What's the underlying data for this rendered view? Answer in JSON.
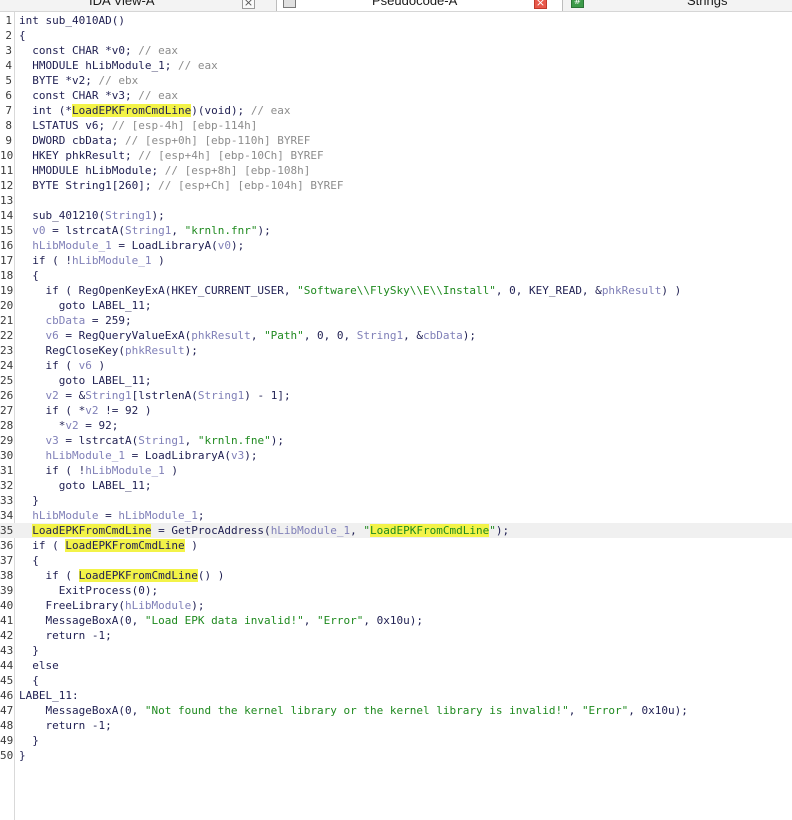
{
  "tabs": [
    {
      "title": "IDA View-A",
      "close": "×",
      "active": false
    },
    {
      "title": "Pseudocode-A",
      "close": "×",
      "active": true
    },
    {
      "title": "Strings",
      "icon": "#",
      "active": false
    }
  ],
  "highlight_word": "LoadEPKFromCmdLine",
  "code_lines": [
    {
      "n": "1",
      "parts": [
        {
          "t": "int sub_4010AD()",
          "k": "p"
        }
      ]
    },
    {
      "n": "2",
      "parts": [
        {
          "t": "{",
          "k": "p"
        }
      ]
    },
    {
      "n": "3",
      "parts": [
        {
          "t": "  const CHAR *v0; ",
          "k": "p"
        },
        {
          "t": "// eax",
          "k": "c"
        }
      ]
    },
    {
      "n": "4",
      "parts": [
        {
          "t": "  HMODULE hLibModule_1; ",
          "k": "p"
        },
        {
          "t": "// eax",
          "k": "c"
        }
      ]
    },
    {
      "n": "5",
      "parts": [
        {
          "t": "  BYTE *v2; ",
          "k": "p"
        },
        {
          "t": "// ebx",
          "k": "c"
        }
      ]
    },
    {
      "n": "6",
      "parts": [
        {
          "t": "  const CHAR *v3; ",
          "k": "p"
        },
        {
          "t": "// eax",
          "k": "c"
        }
      ]
    },
    {
      "n": "7",
      "parts": [
        {
          "t": "  int (*",
          "k": "p"
        },
        {
          "t": "LoadEPKFromCmdLine",
          "k": "h"
        },
        {
          "t": ")(void); ",
          "k": "p"
        },
        {
          "t": "// eax",
          "k": "c"
        }
      ]
    },
    {
      "n": "8",
      "parts": [
        {
          "t": "  LSTATUS v6; ",
          "k": "p"
        },
        {
          "t": "// [esp-4h] [ebp-114h]",
          "k": "c"
        }
      ]
    },
    {
      "n": "9",
      "parts": [
        {
          "t": "  DWORD cbData; ",
          "k": "p"
        },
        {
          "t": "// [esp+0h] [ebp-110h] BYREF",
          "k": "c"
        }
      ]
    },
    {
      "n": "10",
      "parts": [
        {
          "t": "  HKEY phkResult; ",
          "k": "p"
        },
        {
          "t": "// [esp+4h] [ebp-10Ch] BYREF",
          "k": "c"
        }
      ]
    },
    {
      "n": "11",
      "parts": [
        {
          "t": "  HMODULE hLibModule; ",
          "k": "p"
        },
        {
          "t": "// [esp+8h] [ebp-108h]",
          "k": "c"
        }
      ]
    },
    {
      "n": "12",
      "parts": [
        {
          "t": "  BYTE String1[260]; ",
          "k": "p"
        },
        {
          "t": "// [esp+Ch] [ebp-104h] BYREF",
          "k": "c"
        }
      ]
    },
    {
      "n": "13",
      "parts": []
    },
    {
      "n": "14",
      "parts": [
        {
          "t": "  sub_401210(",
          "k": "p"
        },
        {
          "t": "String1",
          "k": "v"
        },
        {
          "t": ");",
          "k": "p"
        }
      ]
    },
    {
      "n": "15",
      "parts": [
        {
          "t": "  ",
          "k": "p"
        },
        {
          "t": "v0",
          "k": "v"
        },
        {
          "t": " = lstrcatA(",
          "k": "p"
        },
        {
          "t": "String1",
          "k": "v"
        },
        {
          "t": ", ",
          "k": "p"
        },
        {
          "t": "\"krnln.fnr\"",
          "k": "s"
        },
        {
          "t": ");",
          "k": "p"
        }
      ]
    },
    {
      "n": "16",
      "parts": [
        {
          "t": "  ",
          "k": "p"
        },
        {
          "t": "hLibModule_1",
          "k": "v"
        },
        {
          "t": " = LoadLibraryA(",
          "k": "p"
        },
        {
          "t": "v0",
          "k": "v"
        },
        {
          "t": ");",
          "k": "p"
        }
      ]
    },
    {
      "n": "17",
      "parts": [
        {
          "t": "  if ( !",
          "k": "p"
        },
        {
          "t": "hLibModule_1",
          "k": "v"
        },
        {
          "t": " )",
          "k": "p"
        }
      ]
    },
    {
      "n": "18",
      "parts": [
        {
          "t": "  {",
          "k": "p"
        }
      ]
    },
    {
      "n": "19",
      "parts": [
        {
          "t": "    if ( RegOpenKeyExA(HKEY_CURRENT_USER, ",
          "k": "p"
        },
        {
          "t": "\"Software\\\\FlySky\\\\E\\\\Install\"",
          "k": "s"
        },
        {
          "t": ", 0, KEY_READ, &",
          "k": "p"
        },
        {
          "t": "phkResult",
          "k": "v"
        },
        {
          "t": ") )",
          "k": "p"
        }
      ]
    },
    {
      "n": "20",
      "parts": [
        {
          "t": "      goto LABEL_11;",
          "k": "p"
        }
      ]
    },
    {
      "n": "21",
      "parts": [
        {
          "t": "    ",
          "k": "p"
        },
        {
          "t": "cbData",
          "k": "v"
        },
        {
          "t": " = 259;",
          "k": "p"
        }
      ]
    },
    {
      "n": "22",
      "parts": [
        {
          "t": "    ",
          "k": "p"
        },
        {
          "t": "v6",
          "k": "v"
        },
        {
          "t": " = RegQueryValueExA(",
          "k": "p"
        },
        {
          "t": "phkResult",
          "k": "v"
        },
        {
          "t": ", ",
          "k": "p"
        },
        {
          "t": "\"Path\"",
          "k": "s"
        },
        {
          "t": ", 0, 0, ",
          "k": "p"
        },
        {
          "t": "String1",
          "k": "v"
        },
        {
          "t": ", &",
          "k": "p"
        },
        {
          "t": "cbData",
          "k": "v"
        },
        {
          "t": ");",
          "k": "p"
        }
      ]
    },
    {
      "n": "23",
      "parts": [
        {
          "t": "    RegCloseKey(",
          "k": "p"
        },
        {
          "t": "phkResult",
          "k": "v"
        },
        {
          "t": ");",
          "k": "p"
        }
      ]
    },
    {
      "n": "24",
      "parts": [
        {
          "t": "    if ( ",
          "k": "p"
        },
        {
          "t": "v6",
          "k": "v"
        },
        {
          "t": " )",
          "k": "p"
        }
      ]
    },
    {
      "n": "25",
      "parts": [
        {
          "t": "      goto LABEL_11;",
          "k": "p"
        }
      ]
    },
    {
      "n": "26",
      "parts": [
        {
          "t": "    ",
          "k": "p"
        },
        {
          "t": "v2",
          "k": "v"
        },
        {
          "t": " = &",
          "k": "p"
        },
        {
          "t": "String1",
          "k": "v"
        },
        {
          "t": "[lstrlenA(",
          "k": "p"
        },
        {
          "t": "String1",
          "k": "v"
        },
        {
          "t": ") - 1];",
          "k": "p"
        }
      ]
    },
    {
      "n": "27",
      "parts": [
        {
          "t": "    if ( *",
          "k": "p"
        },
        {
          "t": "v2",
          "k": "v"
        },
        {
          "t": " != 92 )",
          "k": "p"
        }
      ]
    },
    {
      "n": "28",
      "parts": [
        {
          "t": "      *",
          "k": "p"
        },
        {
          "t": "v2",
          "k": "v"
        },
        {
          "t": " = 92;",
          "k": "p"
        }
      ]
    },
    {
      "n": "29",
      "parts": [
        {
          "t": "    ",
          "k": "p"
        },
        {
          "t": "v3",
          "k": "v"
        },
        {
          "t": " = lstrcatA(",
          "k": "p"
        },
        {
          "t": "String1",
          "k": "v"
        },
        {
          "t": ", ",
          "k": "p"
        },
        {
          "t": "\"krnln.fne\"",
          "k": "s"
        },
        {
          "t": ");",
          "k": "p"
        }
      ]
    },
    {
      "n": "30",
      "parts": [
        {
          "t": "    ",
          "k": "p"
        },
        {
          "t": "hLibModule_1",
          "k": "v"
        },
        {
          "t": " = LoadLibraryA(",
          "k": "p"
        },
        {
          "t": "v3",
          "k": "v"
        },
        {
          "t": ");",
          "k": "p"
        }
      ]
    },
    {
      "n": "31",
      "parts": [
        {
          "t": "    if ( !",
          "k": "p"
        },
        {
          "t": "hLibModule_1",
          "k": "v"
        },
        {
          "t": " )",
          "k": "p"
        }
      ]
    },
    {
      "n": "32",
      "parts": [
        {
          "t": "      goto LABEL_11;",
          "k": "p"
        }
      ]
    },
    {
      "n": "33",
      "parts": [
        {
          "t": "  }",
          "k": "p"
        }
      ]
    },
    {
      "n": "34",
      "parts": [
        {
          "t": "  ",
          "k": "p"
        },
        {
          "t": "hLibModule",
          "k": "v"
        },
        {
          "t": " = ",
          "k": "p"
        },
        {
          "t": "hLibModule_1",
          "k": "v"
        },
        {
          "t": ";",
          "k": "p"
        }
      ]
    },
    {
      "n": "35",
      "cur": true,
      "parts": [
        {
          "t": "  ",
          "k": "p"
        },
        {
          "t": "LoadEPKFromCmdLine",
          "k": "h"
        },
        {
          "t": " = GetProcAddress(",
          "k": "p"
        },
        {
          "t": "hLibModule_1",
          "k": "v"
        },
        {
          "t": ", ",
          "k": "p"
        },
        {
          "t": "\"",
          "k": "s"
        },
        {
          "t": "LoadEPKFromCmdLine",
          "k": "hs"
        },
        {
          "t": "\"",
          "k": "s"
        },
        {
          "t": ");",
          "k": "p"
        }
      ]
    },
    {
      "n": "36",
      "parts": [
        {
          "t": "  if ( ",
          "k": "p"
        },
        {
          "t": "LoadEPKFromCmdLine",
          "k": "h"
        },
        {
          "t": " )",
          "k": "p"
        }
      ]
    },
    {
      "n": "37",
      "parts": [
        {
          "t": "  {",
          "k": "p"
        }
      ]
    },
    {
      "n": "38",
      "parts": [
        {
          "t": "    if ( ",
          "k": "p"
        },
        {
          "t": "LoadEPKFromCmdLine",
          "k": "h"
        },
        {
          "t": "() )",
          "k": "p"
        }
      ]
    },
    {
      "n": "39",
      "parts": [
        {
          "t": "      ExitProcess(0);",
          "k": "p"
        }
      ]
    },
    {
      "n": "40",
      "parts": [
        {
          "t": "    FreeLibrary(",
          "k": "p"
        },
        {
          "t": "hLibModule",
          "k": "v"
        },
        {
          "t": ");",
          "k": "p"
        }
      ]
    },
    {
      "n": "41",
      "parts": [
        {
          "t": "    MessageBoxA(0, ",
          "k": "p"
        },
        {
          "t": "\"Load EPK data invalid!\"",
          "k": "s"
        },
        {
          "t": ", ",
          "k": "p"
        },
        {
          "t": "\"Error\"",
          "k": "s"
        },
        {
          "t": ", 0x10u);",
          "k": "p"
        }
      ]
    },
    {
      "n": "42",
      "parts": [
        {
          "t": "    return -1;",
          "k": "p"
        }
      ]
    },
    {
      "n": "43",
      "parts": [
        {
          "t": "  }",
          "k": "p"
        }
      ]
    },
    {
      "n": "44",
      "parts": [
        {
          "t": "  else",
          "k": "p"
        }
      ]
    },
    {
      "n": "45",
      "parts": [
        {
          "t": "  {",
          "k": "p"
        }
      ]
    },
    {
      "n": "46",
      "parts": [
        {
          "t": "LABEL_11:",
          "k": "p"
        }
      ]
    },
    {
      "n": "47",
      "parts": [
        {
          "t": "    MessageBoxA(0, ",
          "k": "p"
        },
        {
          "t": "\"Not found the kernel library or the kernel library is invalid!\"",
          "k": "s"
        },
        {
          "t": ", ",
          "k": "p"
        },
        {
          "t": "\"Error\"",
          "k": "s"
        },
        {
          "t": ", 0x10u);",
          "k": "p"
        }
      ]
    },
    {
      "n": "48",
      "parts": [
        {
          "t": "    return -1;",
          "k": "p"
        }
      ]
    },
    {
      "n": "49",
      "parts": [
        {
          "t": "  }",
          "k": "p"
        }
      ]
    },
    {
      "n": "50",
      "parts": [
        {
          "t": "}",
          "k": "p"
        }
      ]
    }
  ],
  "colors": {
    "plain": "#1f1f52",
    "comment": "#8c8c8c",
    "string": "#1f8a1f",
    "variable": "#8080b8",
    "highlight": "#f3f348",
    "current_line": "#f0f0f0",
    "active_close": "#e8584a"
  }
}
